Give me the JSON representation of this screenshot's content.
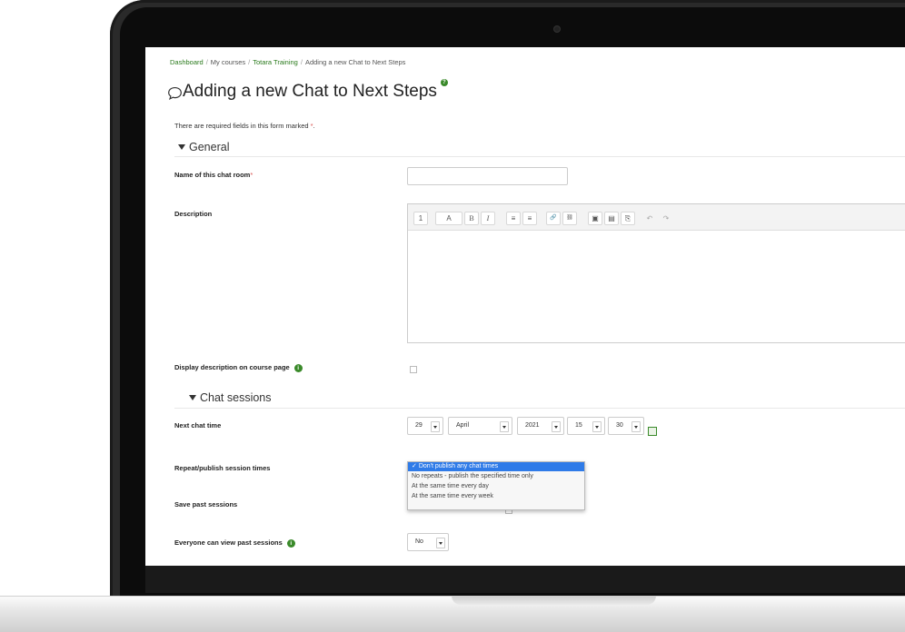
{
  "breadcrumb": {
    "items": [
      {
        "label": "Dashboard",
        "link": true
      },
      {
        "label": "My courses",
        "link": false
      },
      {
        "label": "Totara Training",
        "link": true
      },
      {
        "label": "Adding a new Chat to Next Steps",
        "link": false
      }
    ],
    "separator": "/"
  },
  "page": {
    "title": "Adding a new Chat to Next Steps",
    "required_note": "There are required fields in this form marked",
    "required_marker": "*"
  },
  "sections": {
    "general": "General",
    "chat_sessions": "Chat sessions"
  },
  "fields": {
    "name_label": "Name of this chat room",
    "name_value": "",
    "description_label": "Description",
    "display_description_label": "Display description on course page",
    "next_chat_time_label": "Next chat time",
    "repeat_label": "Repeat/publish session times",
    "save_past_label": "Save past sessions",
    "everyone_view_label": "Everyone can view past sessions"
  },
  "next_chat_time": {
    "day": "29",
    "month": "April",
    "year": "2021",
    "hour": "15",
    "minute": "30"
  },
  "repeat_options": [
    "Don't publish any chat times",
    "No repeats - publish the specified time only",
    "At the same time every day",
    "At the same time every week"
  ],
  "repeat_selected_index": 0,
  "repeat_check": "✓",
  "everyone_view_value": "No",
  "editor_toolbar": {
    "buttons": [
      "1",
      "A",
      "B",
      "I",
      "≡",
      "≡",
      "🔗",
      "⛓",
      "▣",
      "▤",
      "⎘",
      "↶",
      "↷"
    ]
  },
  "colors": {
    "link": "#2a7a1c",
    "required": "#d9534f",
    "info": "#3a8a2a",
    "dropdown_highlight": "#2f7be8"
  }
}
